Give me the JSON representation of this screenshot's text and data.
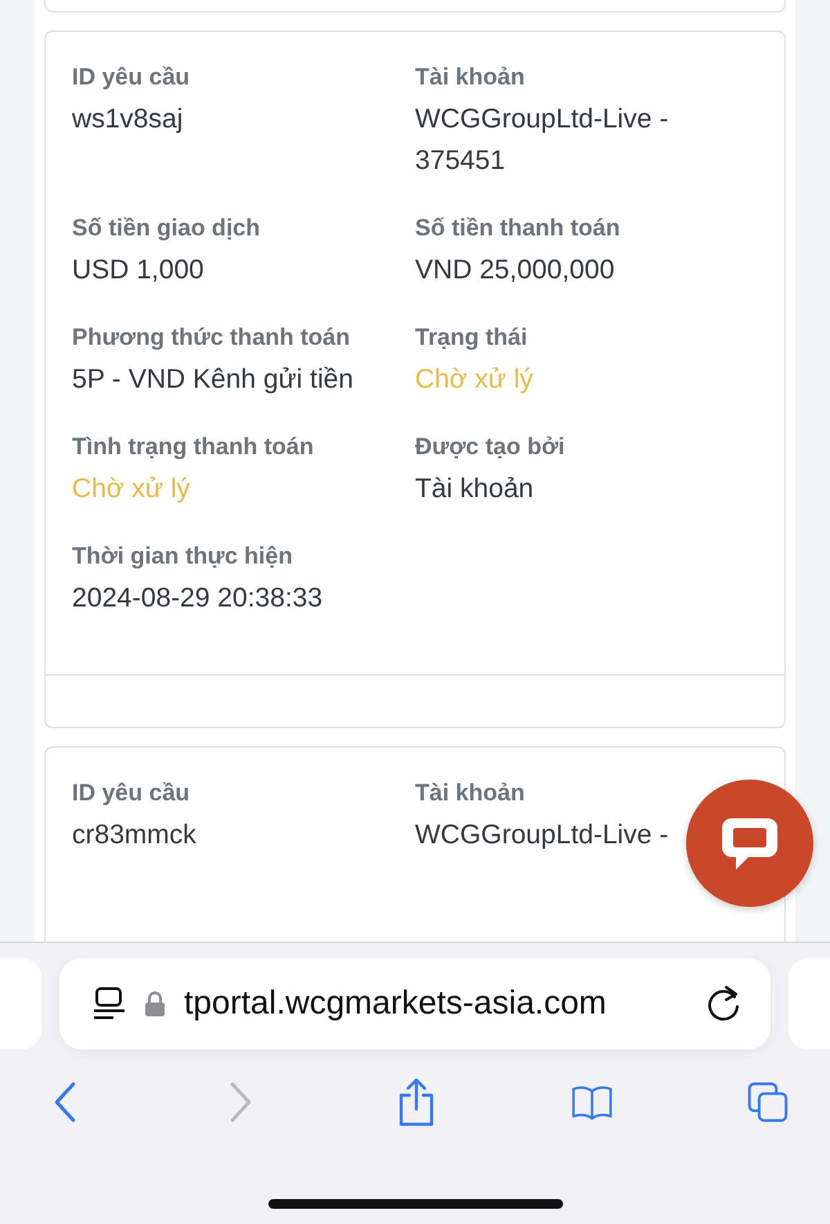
{
  "cards": [
    {
      "fields": [
        {
          "label": "ID yêu cầu",
          "value": "ws1v8saj",
          "kind": "plain"
        },
        {
          "label": "Tài khoản",
          "value": "WCGGroupLtd-Live - 375451",
          "kind": "plain"
        },
        {
          "label": "Số tiền giao dịch",
          "value": "USD 1,000",
          "kind": "plain"
        },
        {
          "label": "Số tiền thanh toán",
          "value": "VND 25,000,000",
          "kind": "plain"
        },
        {
          "label": "Phương thức thanh toán",
          "value": "5P - VND Kênh gửi tiền",
          "kind": "plain"
        },
        {
          "label": "Trạng thái",
          "value": "Chờ xử lý",
          "kind": "pending"
        },
        {
          "label": "Tình trạng thanh toán",
          "value": "Chờ xử lý",
          "kind": "pending"
        },
        {
          "label": "Được tạo bởi",
          "value": "Tài khoản",
          "kind": "plain"
        },
        {
          "label": "Thời gian thực hiện",
          "value": "2024-08-29 20:38:33",
          "kind": "plain"
        }
      ]
    },
    {
      "fields": [
        {
          "label": "ID yêu cầu",
          "value": "cr83mmck",
          "kind": "plain"
        },
        {
          "label": "Tài khoản",
          "value": "WCGGroupLtd-Live -",
          "kind": "plain"
        }
      ]
    }
  ],
  "browser": {
    "url": "tportal.wcgmarkets-asia.com",
    "toolbar": [
      {
        "kind": "back",
        "disabled": false
      },
      {
        "kind": "forward",
        "disabled": true
      },
      {
        "kind": "share",
        "disabled": false
      },
      {
        "kind": "bookmarks",
        "disabled": false
      },
      {
        "kind": "tabs",
        "disabled": false
      }
    ]
  }
}
